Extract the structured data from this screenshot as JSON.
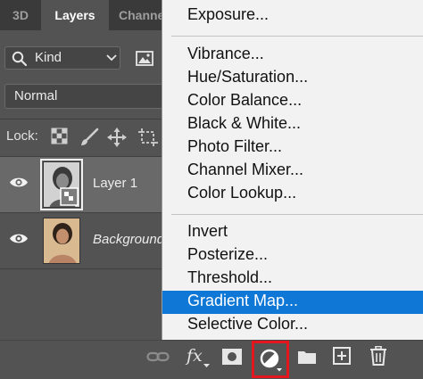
{
  "tabs": [
    {
      "label": "3D"
    },
    {
      "label": "Layers"
    },
    {
      "label": "Channels"
    }
  ],
  "filter": {
    "kind_label": "Kind"
  },
  "blend_mode": {
    "value": "Normal"
  },
  "lock": {
    "label": "Lock:"
  },
  "layers": [
    {
      "name": "Layer 1",
      "selected": true,
      "visible": true
    },
    {
      "name": "Background",
      "selected": false,
      "visible": true
    }
  ],
  "adjustment_menu": {
    "groups": [
      [
        "Exposure..."
      ],
      [
        "Vibrance...",
        "Hue/Saturation...",
        "Color Balance...",
        "Black & White...",
        "Photo Filter...",
        "Channel Mixer...",
        "Color Lookup..."
      ],
      [
        "Invert",
        "Posterize...",
        "Threshold...",
        "Gradient Map...",
        "Selective Color..."
      ]
    ],
    "highlighted": "Gradient Map..."
  },
  "bottom_toolbar": {
    "fx_label": "fx",
    "icons": [
      "link-layers-icon",
      "fx-icon",
      "mask-icon",
      "adjustment-layer-icon",
      "group-folder-icon",
      "new-layer-icon",
      "trash-icon"
    ]
  },
  "colors": {
    "panel_bg": "#535353",
    "menu_bg": "#f2f2f2",
    "highlight": "#0f78d7",
    "callout_border": "#e3171d"
  }
}
